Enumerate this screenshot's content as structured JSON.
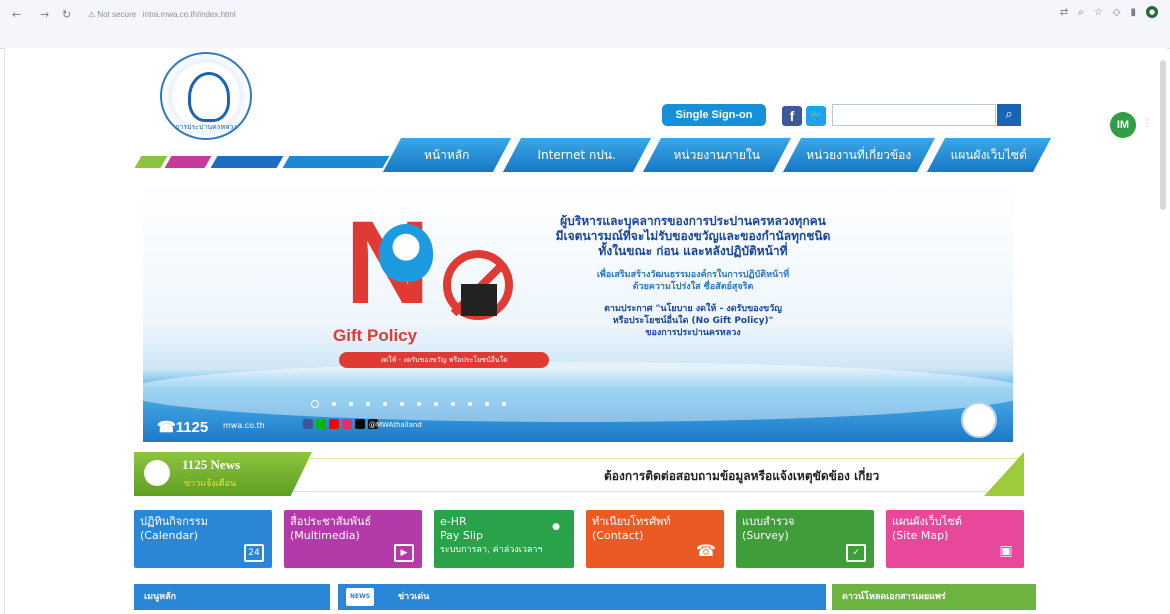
{
  "browser": {
    "url_status": "Not secure",
    "url": "intra.mwa.co.th/index.html"
  },
  "header": {
    "logo_text": "การประปานครหลวง",
    "sso_label": "Single Sign-on",
    "facebook_label": "f",
    "twitter_label": "t",
    "search_placeholder": ""
  },
  "nav": {
    "tabs": [
      "หน้าหลัก",
      "Internet กปน.",
      "หน่วยงานภายใน",
      "หน่วยงานที่เกี่ยวข้อง",
      "แผนผังเว็บไซต์"
    ]
  },
  "banner": {
    "gift_policy": "Gift Policy",
    "tagline": "งดให้ - งดรับของขวัญ หรือประโยชน์อื่นใด",
    "main_lines": [
      "ผู้บริหารและบุคลากรของการประปานครหลวงทุกคน",
      "มีเจตนารมณ์ที่จะไม่รับของขวัญและของกำนัลทุกชนิด",
      "ทั้งในขณะ ก่อน และหลังปฏิบัติหน้าที่"
    ],
    "sub_lines": [
      "เพื่อเสริมสร้างวัฒนธรรมองค์กรในการปฏิบัติหน้าที่",
      "ด้วยความโปร่งใส ซื่อสัตย์สุจริต"
    ],
    "note_lines": [
      "ตามประกาศ \"นโยบาย งดให้ - งดรับของขวัญ",
      "หรือประโยชน์อื่นใด (No Gift Policy)\"",
      "ของการประปานครหลวง"
    ],
    "hotline": "1125",
    "website": "mwa.co.th",
    "handle": "@MWAthailand",
    "slide_count": 12,
    "active_slide": 1
  },
  "news": {
    "title": "1125 News",
    "subtitle": "ข่าวแจ้งเตือน",
    "message": "ต้องการติดต่อสอบถามข้อมูลหรือแจ้งเหตุขัดข้อง เกี่ยว"
  },
  "tiles": [
    {
      "line1": "ปฏิทินกิจกรรม",
      "line2": "(Calendar)",
      "icon": "calendar-icon",
      "icon_text": "24",
      "color": "#2a86d6"
    },
    {
      "line1": "สื่อประชาสัมพันธ์",
      "line2": "(Multimedia)",
      "icon": "video-icon",
      "icon_text": "▶",
      "color": "#b53aa9"
    },
    {
      "line1": "e-HR",
      "line2": "Pay Slip",
      "line3": "ระบบการลา, ค่าล่วงเวลาฯ",
      "icon": "user-icon",
      "icon_text": "●",
      "color": "#2aa24a"
    },
    {
      "line1": "ทำเนียบโทรศัพท์",
      "line2": "(Contact)",
      "icon": "phone-icon",
      "icon_text": "☎",
      "color": "#ec5a24"
    },
    {
      "line1": "แบบสำรวจ",
      "line2": "(Survey)",
      "icon": "checkbox-icon",
      "icon_text": "✓",
      "color": "#3f9e3a"
    },
    {
      "line1": "แผนผังเว็บไซต์",
      "line2": "(Site Map)",
      "icon": "sitemap-icon",
      "icon_text": "▣",
      "color": "#e8479a"
    }
  ],
  "bottom": {
    "menu": "เมนูหลัก",
    "highlight": "ข่าวเด่น",
    "news_icon": "NEWS",
    "download": "ดาวน์โหลดเอกสารเผยแพร่"
  }
}
